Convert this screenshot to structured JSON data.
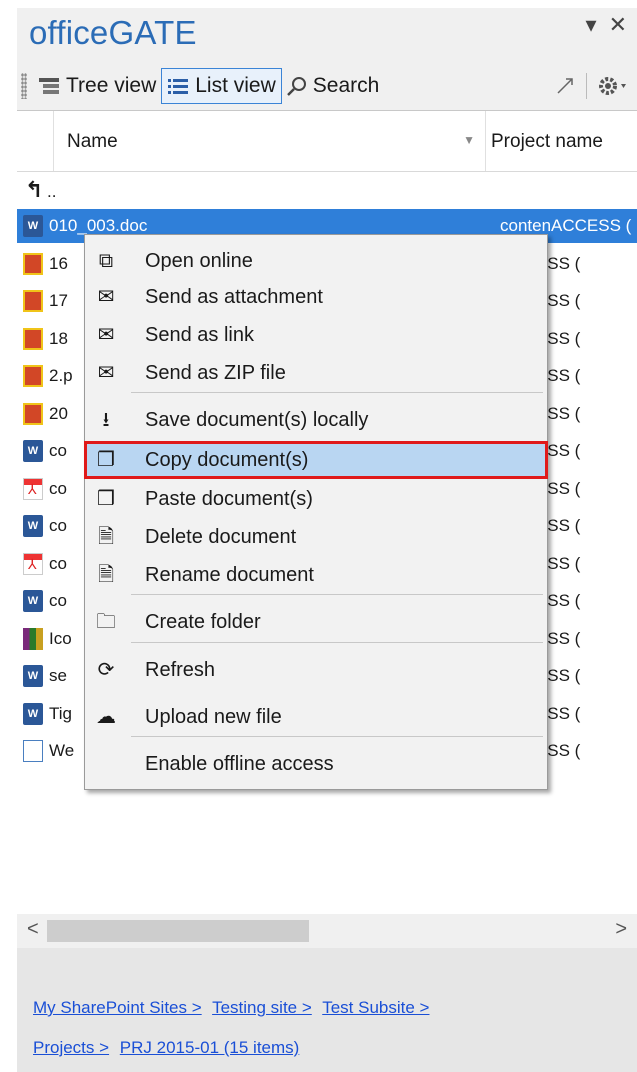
{
  "title": "officeGATE",
  "title_controls": {
    "pin": "▾",
    "close": "✕"
  },
  "toolbar": {
    "tree_view": "Tree view",
    "list_view": "List view",
    "search": "Search"
  },
  "list": {
    "columns": {
      "name": "Name",
      "project": "Project name"
    },
    "up_label": "..",
    "rows": [
      {
        "name": "010_003.doc",
        "project": "contenACCESS (",
        "icon": "word-icon",
        "selected": true
      },
      {
        "name": "16",
        "project": "ACCESS (",
        "icon": "powerpoint-icon"
      },
      {
        "name": "17",
        "project": "ACCESS (",
        "icon": "powerpoint-icon"
      },
      {
        "name": "18",
        "project": "ACCESS (",
        "icon": "powerpoint-icon"
      },
      {
        "name": "2.p",
        "project": "ACCESS (",
        "icon": "powerpoint-icon"
      },
      {
        "name": "20",
        "project": "ACCESS (",
        "icon": "powerpoint-icon"
      },
      {
        "name": "co",
        "project": "ACCESS (",
        "icon": "word-icon"
      },
      {
        "name": "co",
        "project": "ACCESS (",
        "icon": "pdf-icon"
      },
      {
        "name": "co",
        "project": "ACCESS (",
        "icon": "word-icon"
      },
      {
        "name": "co",
        "project": "ACCESS (",
        "icon": "pdf-icon"
      },
      {
        "name": "co",
        "project": "ACCESS (",
        "icon": "word-icon"
      },
      {
        "name": "Ico",
        "project": "ACCESS (",
        "icon": "archive-icon"
      },
      {
        "name": "se",
        "project": "ACCESS (",
        "icon": "word-icon"
      },
      {
        "name": "Tig",
        "project": "ACCESS (",
        "icon": "word-icon"
      },
      {
        "name": "We",
        "project": "ACCESS (",
        "icon": "generic-file-icon"
      }
    ]
  },
  "context_menu": {
    "items": [
      {
        "label": "Open online",
        "icon": "open-external-icon",
        "glyph": "⧉"
      },
      {
        "label": "Send as attachment",
        "icon": "mail-attachment-icon",
        "glyph": "✉"
      },
      {
        "label": "Send as link",
        "icon": "mail-link-icon",
        "glyph": "✉"
      },
      {
        "label": "Send as ZIP file",
        "icon": "mail-zip-icon",
        "glyph": "✉"
      },
      {
        "label": "Save document(s) locally",
        "icon": "download-icon",
        "glyph": "⭳"
      },
      {
        "label": "Copy document(s)",
        "icon": "copy-icon",
        "glyph": "❐",
        "highlighted": true
      },
      {
        "label": "Paste document(s)",
        "icon": "paste-icon",
        "glyph": "❒"
      },
      {
        "label": "Delete document",
        "icon": "delete-document-icon",
        "glyph": "🗎"
      },
      {
        "label": "Rename document",
        "icon": "rename-document-icon",
        "glyph": "🗎"
      },
      {
        "label": "Create folder",
        "icon": "create-folder-icon",
        "glyph": "🗀"
      },
      {
        "label": "Refresh",
        "icon": "refresh-icon",
        "glyph": "⟳"
      },
      {
        "label": "Upload new file",
        "icon": "upload-cloud-icon",
        "glyph": "☁"
      },
      {
        "label": "Enable offline access",
        "icon": "offline-access-icon",
        "glyph": ""
      }
    ]
  },
  "breadcrumbs": [
    "My SharePoint Sites >",
    "Testing site >",
    "Test Subsite >",
    "Projects >",
    "PRJ 2015-01 (15 items)"
  ]
}
